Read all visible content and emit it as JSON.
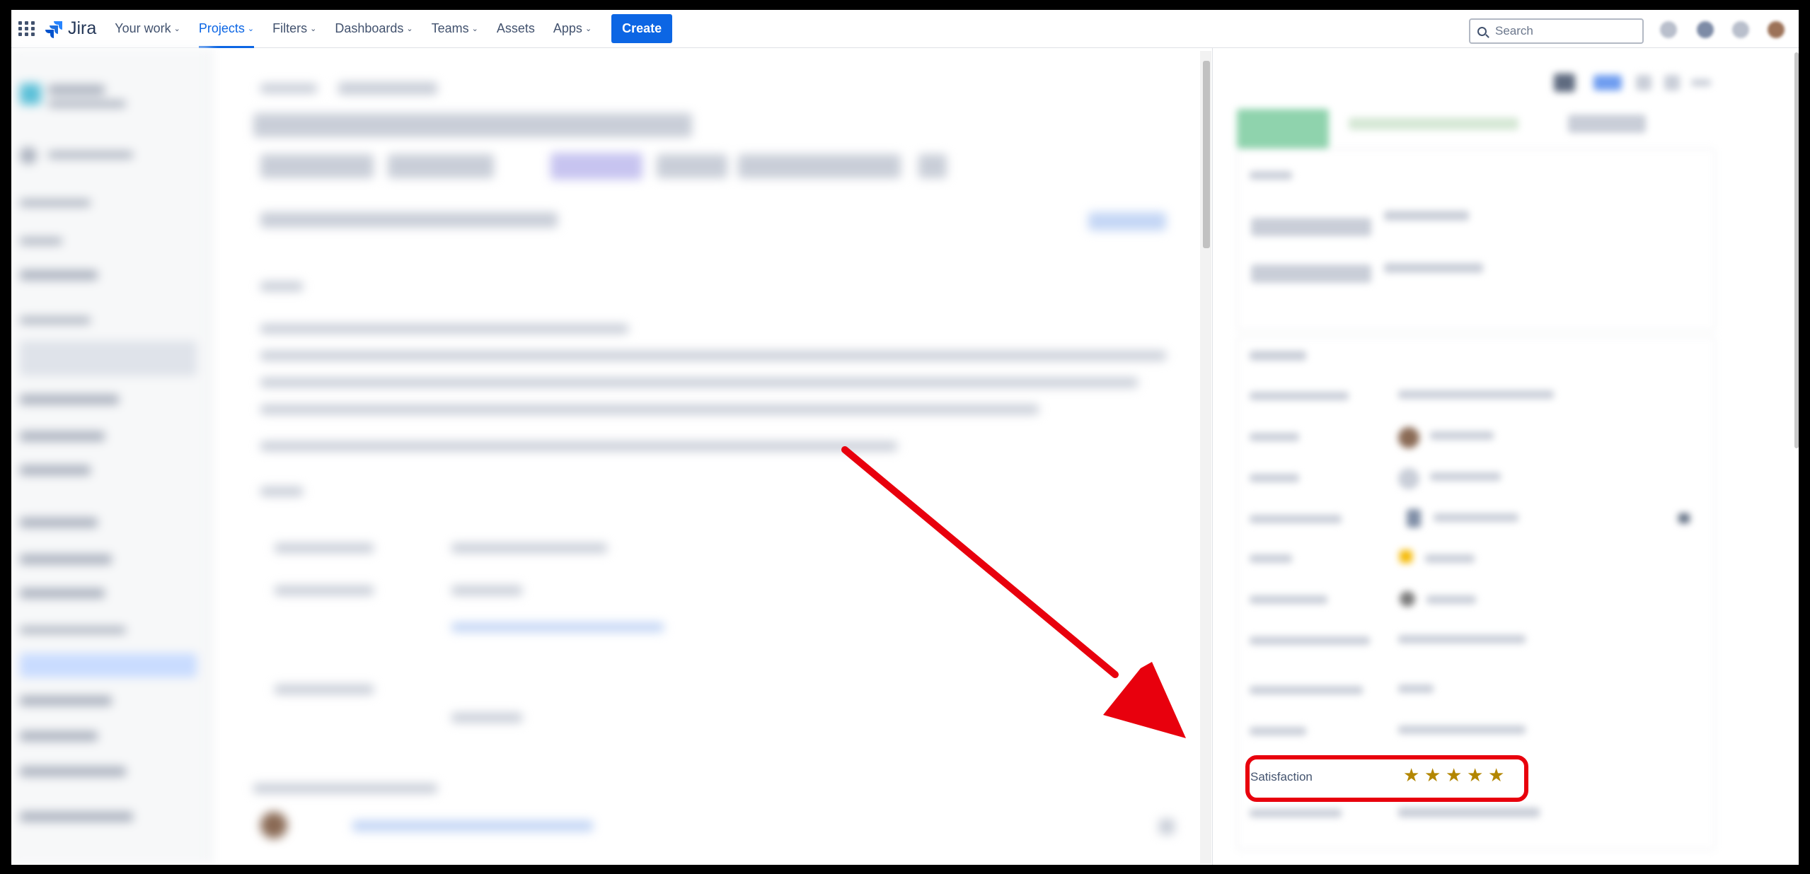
{
  "nav": {
    "logo_text": "Jira",
    "items": [
      {
        "label": "Your work",
        "has_chevron": true,
        "active": false
      },
      {
        "label": "Projects",
        "has_chevron": true,
        "active": true
      },
      {
        "label": "Filters",
        "has_chevron": true,
        "active": false
      },
      {
        "label": "Dashboards",
        "has_chevron": true,
        "active": false
      },
      {
        "label": "Teams",
        "has_chevron": true,
        "active": false
      },
      {
        "label": "Assets",
        "has_chevron": false,
        "active": false
      },
      {
        "label": "Apps",
        "has_chevron": true,
        "active": false
      }
    ],
    "create_label": "Create",
    "search_placeholder": "Search",
    "accent_color": "#0c66e4"
  },
  "details": {
    "satisfaction_label": "Satisfaction",
    "satisfaction_rating": 5,
    "satisfaction_max": 5,
    "star_glyph": "★",
    "star_color": "#b38600"
  },
  "annotation": {
    "highlight_color": "#e8000d",
    "arrow_color": "#e8000d"
  }
}
